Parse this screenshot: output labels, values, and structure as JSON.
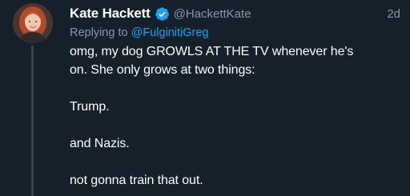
{
  "tweet": {
    "display_name": "Kate Hackett",
    "handle": "@HackettKate",
    "timestamp": "2d",
    "replying_label": "Replying to",
    "replying_to": "@FulginitiGreg",
    "paragraphs": [
      "omg, my dog GROWLS AT THE TV whenever he's",
      "on. She only grows at two things:",
      "Trump.",
      "and Nazis.",
      "not gonna train that out."
    ]
  },
  "colors": {
    "background": "#15202b",
    "text_primary": "#ffffff",
    "text_secondary": "#8899a6",
    "link": "#1da1f2",
    "verified_badge": "#1da1f2",
    "thread_line": "#38444d"
  },
  "icons": {
    "verified": "verified-badge-icon",
    "avatar": "profile-photo"
  }
}
